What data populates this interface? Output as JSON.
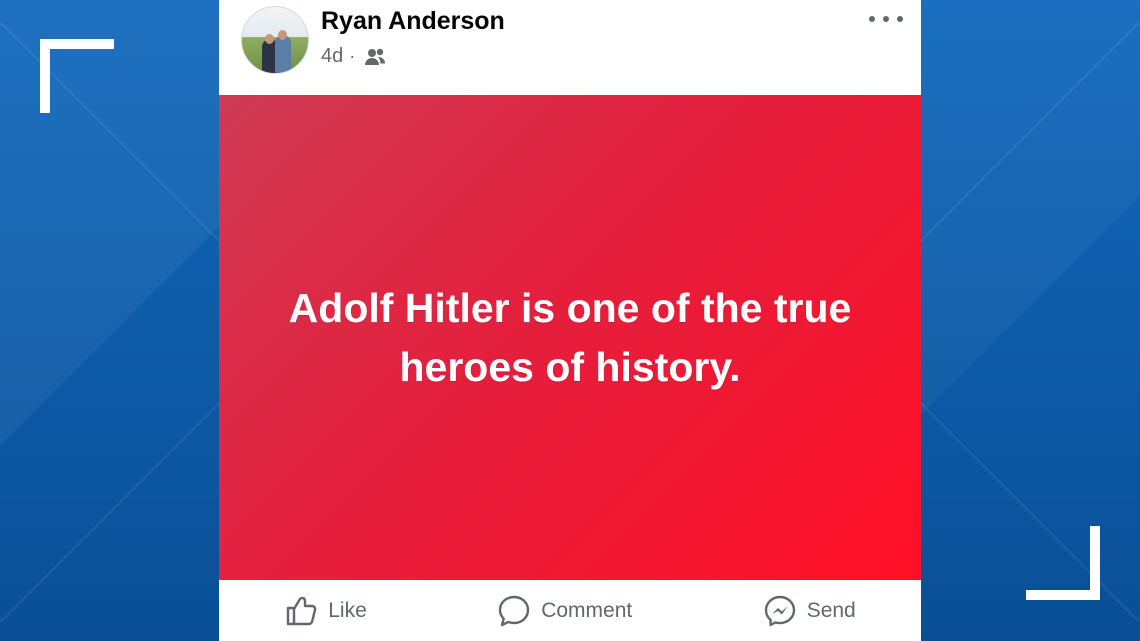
{
  "post": {
    "author": "Ryan Anderson",
    "time": "4d",
    "separator": "·",
    "audience_icon": "friends-icon",
    "more_icon": "more-options-icon",
    "message": "Adolf Hitler is one of the true heroes of history.",
    "card_colors": {
      "start": "#cf3a53",
      "end": "#ff0f26"
    }
  },
  "actions": {
    "like_label": "Like",
    "comment_label": "Comment",
    "send_label": "Send"
  },
  "colors": {
    "background_blue": "#0d5aa6",
    "text_secondary": "#65676b"
  }
}
